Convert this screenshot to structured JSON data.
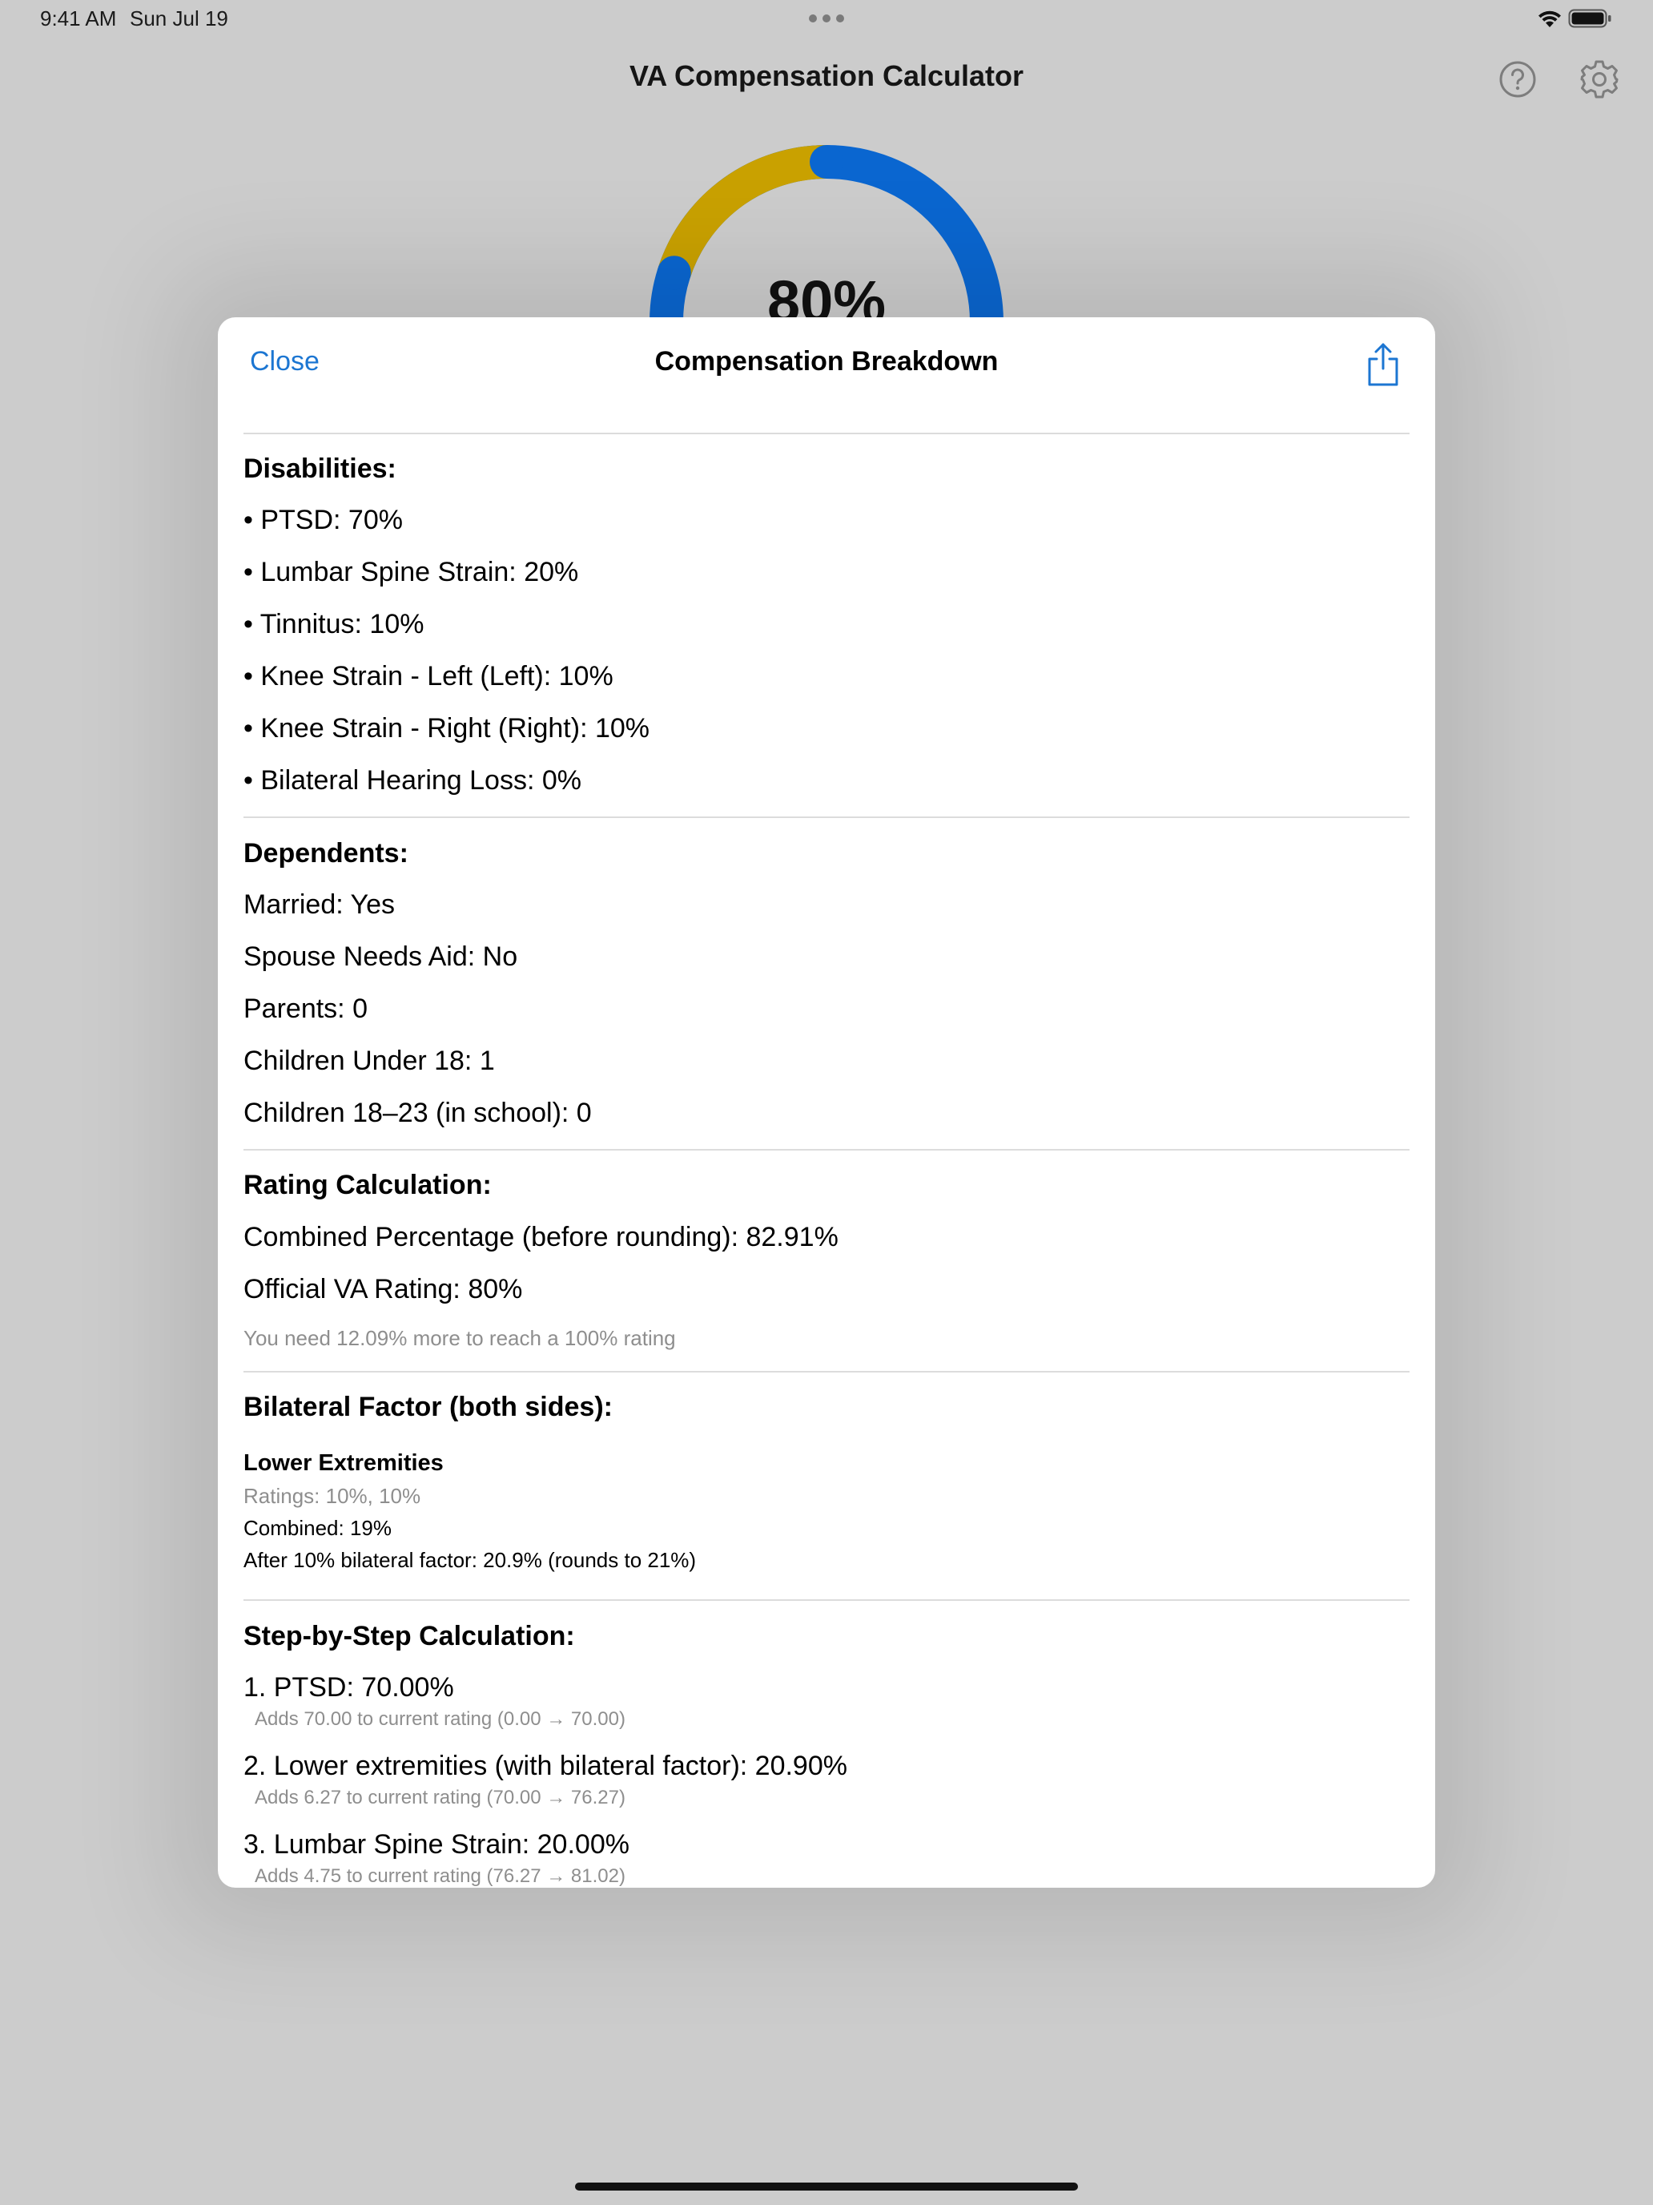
{
  "status_bar": {
    "time": "9:41 AM",
    "date": "Sun Jul 19"
  },
  "app": {
    "title": "VA Compensation Calculator",
    "gauge_value": "80%"
  },
  "colors": {
    "accent": "#1c76d2",
    "gauge_blue": "#0a66d0",
    "gauge_gold": "#c9a100"
  },
  "icons": {
    "help": "question-circle-icon",
    "settings": "gear-icon",
    "share": "share-icon"
  },
  "sheet": {
    "close_label": "Close",
    "title": "Compensation Breakdown",
    "disabilities": {
      "heading": "Disabilities:",
      "items": [
        "• PTSD: 70%",
        "• Lumbar Spine Strain: 20%",
        "• Tinnitus: 10%",
        "• Knee Strain - Left (Left): 10%",
        "• Knee Strain - Right (Right): 10%",
        "• Bilateral Hearing Loss: 0%"
      ]
    },
    "dependents": {
      "heading": "Dependents:",
      "items": [
        "Married: Yes",
        "Spouse Needs Aid: No",
        "Parents: 0",
        "Children Under 18: 1",
        "Children 18–23 (in school): 0"
      ]
    },
    "rating": {
      "heading": "Rating Calculation:",
      "combined": "Combined Percentage (before rounding): 82.91%",
      "official": "Official VA Rating: 80%",
      "note": "You need 12.09% more to reach a 100% rating"
    },
    "bilateral": {
      "heading": "Bilateral Factor (both sides):",
      "group_title": "Lower Extremities",
      "ratings": "Ratings: 10%, 10%",
      "combined": "Combined: 19%",
      "after_factor": "After 10% bilateral factor: 20.9% (rounds to 21%)"
    },
    "steps": {
      "heading": "Step-by-Step Calculation:",
      "items": [
        {
          "label": "1. PTSD: 70.00%",
          "detail": "Adds 70.00 to current rating (0.00 → 70.00)"
        },
        {
          "label": "2. Lower extremities (with bilateral factor): 20.90%",
          "detail": "Adds 6.27 to current rating (70.00 → 76.27)"
        },
        {
          "label": "3. Lumbar Spine Strain: 20.00%",
          "detail": "Adds 4.75 to current rating (76.27 → 81.02)"
        }
      ]
    }
  }
}
